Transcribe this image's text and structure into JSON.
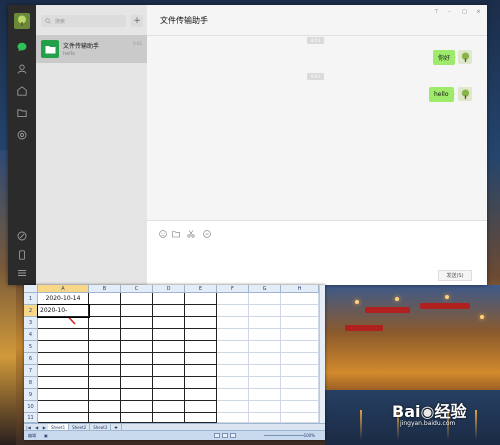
{
  "wechat": {
    "search_placeholder": "搜索",
    "add_label": "+",
    "chat_list": [
      {
        "name": "文件传输助手",
        "preview": "hello",
        "time": "9:02"
      }
    ],
    "chat_title": "文件传输助手",
    "window_controls": {
      "pin": "⊤",
      "minimize": "–",
      "maximize": "□",
      "close": "×"
    },
    "messages": [
      {
        "time": "8:54",
        "text": "你好"
      },
      {
        "time": "9:02",
        "text": "hello"
      }
    ],
    "send_label": "发送(S)",
    "accent_color": "#9eea6a"
  },
  "excel": {
    "columns": [
      "A",
      "B",
      "C",
      "D",
      "E",
      "F",
      "G",
      "H"
    ],
    "rows": [
      "1",
      "2",
      "3",
      "4",
      "5",
      "6",
      "7",
      "8",
      "9",
      "10",
      "11"
    ],
    "cells": {
      "A1": "2020-10-14",
      "A2": "2020-10-"
    },
    "sheet_tabs": [
      "Sheet1",
      "Sheet2",
      "Sheet3"
    ],
    "status_mode": "编辑",
    "zoom": "100%"
  },
  "watermark": {
    "logo_text": "Bai\u0001\u0001经验",
    "sub_text": "jingyan.baidu.com"
  }
}
